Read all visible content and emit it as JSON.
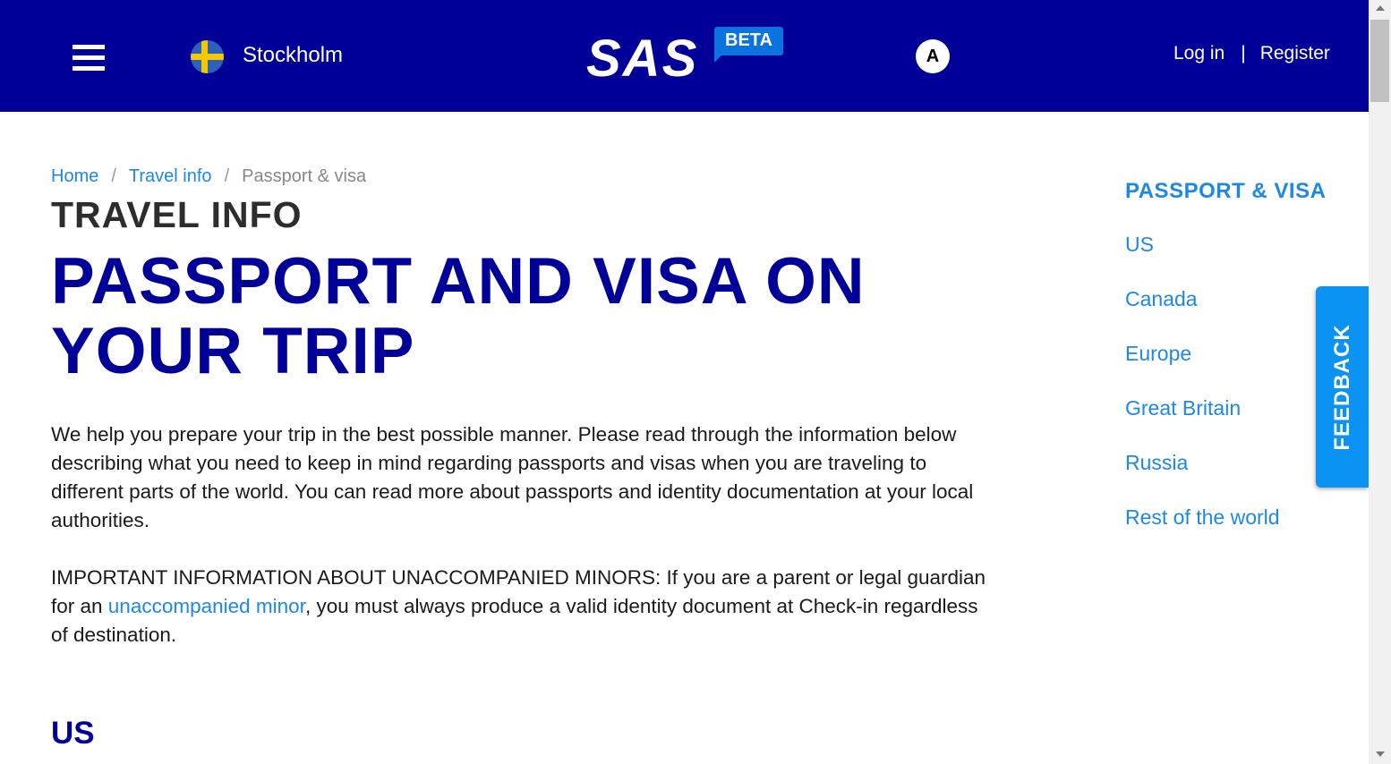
{
  "header": {
    "location": "Stockholm",
    "logo_text": "SAS",
    "logo_badge": "BETA",
    "accessibility_label": "A",
    "login_label": "Log in",
    "separator": "|",
    "register_label": "Register",
    "colors": {
      "background": "#000099",
      "badge": "#0a73e0"
    }
  },
  "breadcrumb": {
    "items": [
      {
        "label": "Home"
      },
      {
        "label": "Travel info"
      },
      {
        "label": "Passport & visa"
      }
    ],
    "separator": "/"
  },
  "main": {
    "kicker": "TRAVEL INFO",
    "title": "PASSPORT AND VISA ON YOUR TRIP",
    "intro": "We help you prepare your trip in the best possible manner. Please read through the information below describing what you need to keep in mind regarding passports and visas when you are traveling to different parts of the world. You can read more about passports and identity documentation at your local authorities.",
    "notice_prefix": "IMPORTANT INFORMATION ABOUT UNACCOMPANIED MINORS: If you are a parent or legal guardian for an ",
    "notice_link": "unaccompanied minor",
    "notice_suffix": ", you must always produce a valid identity document at Check-in regardless of destination.",
    "section_heading": "US"
  },
  "toc": {
    "title": "PASSPORT & VISA",
    "items": [
      "US",
      "Canada",
      "Europe",
      "Great Britain",
      "Russia",
      "Rest of the world"
    ]
  },
  "feedback": {
    "label": "FEEDBACK",
    "color": "#0a93f3"
  }
}
